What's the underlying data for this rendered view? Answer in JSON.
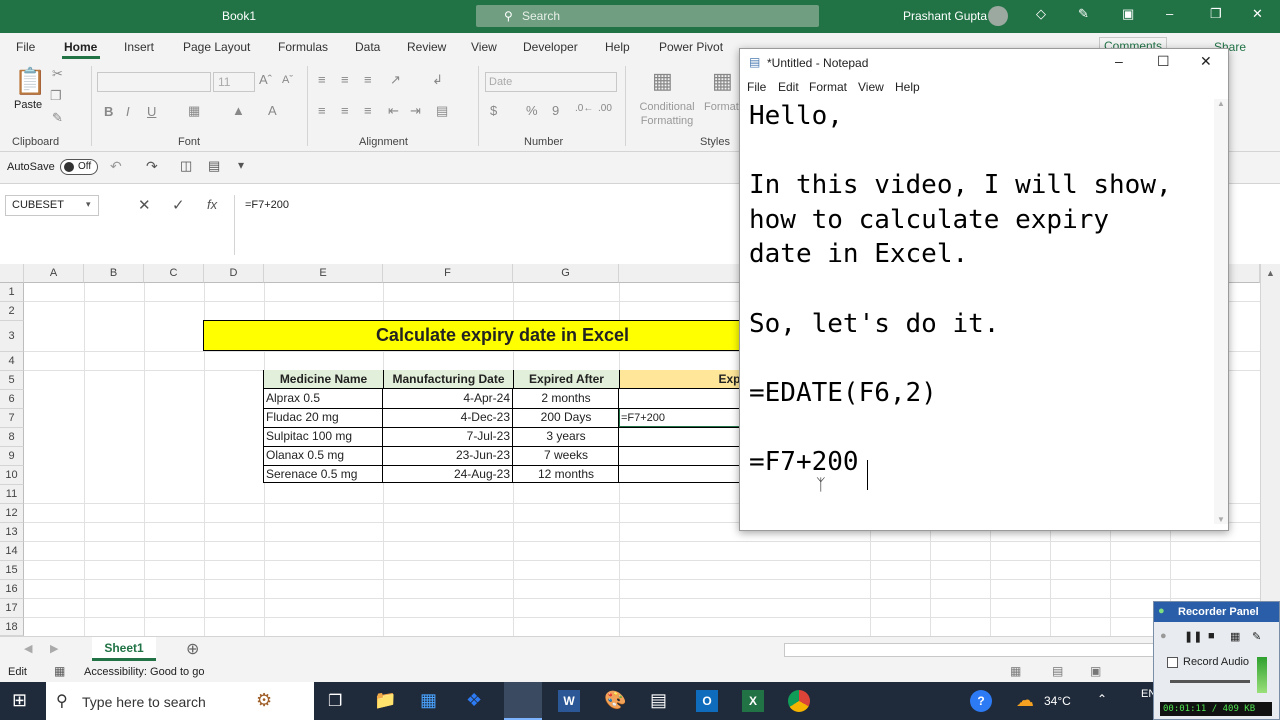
{
  "window": {
    "doc_title": "Book1",
    "search_placeholder": "Search",
    "user": "Prashant Gupta"
  },
  "menu_tabs": [
    "File",
    "Home",
    "Insert",
    "Page Layout",
    "Formulas",
    "Data",
    "Review",
    "View",
    "Developer",
    "Help",
    "Power Pivot"
  ],
  "header_actions": {
    "comments": "Comments",
    "share": "Share"
  },
  "ribbon": {
    "paste": "Paste",
    "groups": [
      "Clipboard",
      "Font",
      "Alignment",
      "Number",
      "Styles"
    ],
    "font_name": "",
    "font_size": "11",
    "number_format": "Date",
    "conditional_formatting": "Conditional Formatting",
    "format_as_table": "Format as Table",
    "bold": "B",
    "italic": "I",
    "underline": "U"
  },
  "qat": {
    "autosave": "AutoSave",
    "autosave_state": "Off"
  },
  "formula_bar": {
    "name_box": "CUBESET",
    "formula": "=F7+200",
    "fx": "fx"
  },
  "columns": [
    "A",
    "B",
    "C",
    "D",
    "E",
    "F",
    "G",
    "H"
  ],
  "rows": [
    "1",
    "2",
    "3",
    "4",
    "5",
    "6",
    "7",
    "8",
    "9",
    "10",
    "11",
    "12",
    "13",
    "14",
    "15",
    "16",
    "17",
    "18"
  ],
  "sheet": {
    "banner": "Calculate expiry date in Excel",
    "headers": [
      "Medicine Name",
      "Manufacturing Date",
      "Expired After",
      "Expiry Date"
    ],
    "data": [
      [
        "Alprax 0.5",
        "4-Apr-24",
        "2 months",
        ""
      ],
      [
        "Fludac 20 mg",
        "4-Dec-23",
        "200 Days",
        "=F7+200"
      ],
      [
        "Sulpitac 100 mg",
        "7-Jul-23",
        "3 years",
        ""
      ],
      [
        "Olanax 0.5 mg",
        "23-Jun-23",
        "7 weeks",
        ""
      ],
      [
        "Serenace 0.5 mg",
        "24-Aug-23",
        "12 months",
        ""
      ]
    ]
  },
  "sheet_tabs": [
    "Sheet1"
  ],
  "status": {
    "mode": "Edit",
    "accessibility": "Accessibility: Good to go"
  },
  "taskbar": {
    "search_placeholder": "Type here to search",
    "temperature": "34°C",
    "lang": "EN"
  },
  "notepad": {
    "title": "*Untitled - Notepad",
    "menu": [
      "File",
      "Edit",
      "Format",
      "View",
      "Help"
    ],
    "content": "Hello,\n\nIn this video, I will show,\nhow to calculate expiry\ndate in Excel.\n\nSo, let's do it.\n\n=EDATE(F6,2)\n\n=F7+200"
  },
  "recorder": {
    "title": "Recorder Panel",
    "record_audio": "Record Audio",
    "timer": "00:01:11 / 409 KB"
  },
  "colors": {
    "excel_green": "#217346",
    "banner_yellow": "#ffff00",
    "header_green": "#e2efda",
    "header_gold": "#ffe699"
  }
}
